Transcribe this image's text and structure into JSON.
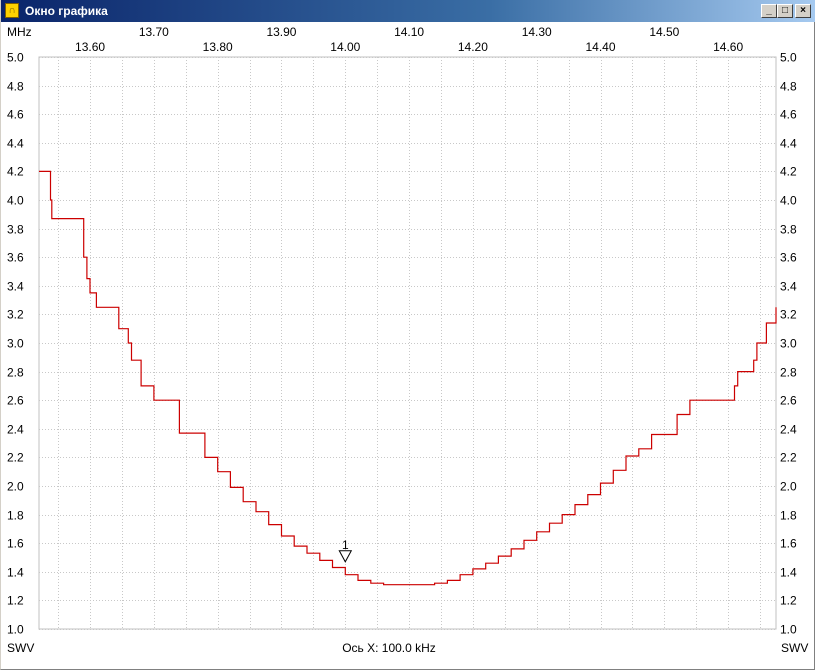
{
  "window": {
    "title": "Окно графика",
    "icon": "chart-app-icon",
    "buttons": {
      "minimize": "_",
      "maximize": "□",
      "close": "×"
    }
  },
  "chart_data": {
    "type": "line",
    "x_unit": "MHz",
    "y_label_left": "SWV",
    "y_label_right": "SWV",
    "x_axis_caption": "Ось X: 100.0 kHz",
    "xlim": [
      13.52,
      14.675
    ],
    "ylim": [
      1.0,
      5.0
    ],
    "x_ticks_upper": [
      "13.70",
      "13.90",
      "14.10",
      "14.30",
      "14.50"
    ],
    "x_ticks_upper_values": [
      13.7,
      13.9,
      14.1,
      14.3,
      14.5
    ],
    "x_ticks_lower": [
      "13.60",
      "13.80",
      "14.00",
      "14.20",
      "14.40",
      "14.60"
    ],
    "x_ticks_lower_values": [
      13.6,
      13.8,
      14.0,
      14.2,
      14.4,
      14.6
    ],
    "y_ticks": [
      "5.0",
      "4.8",
      "4.6",
      "4.4",
      "4.2",
      "4.0",
      "3.8",
      "3.6",
      "3.4",
      "3.2",
      "3.0",
      "2.8",
      "2.6",
      "2.4",
      "2.2",
      "2.0",
      "1.8",
      "1.6",
      "1.4",
      "1.2",
      "1.0"
    ],
    "grid": true,
    "series": [
      {
        "color": "#cc0000",
        "x": [
          13.52,
          13.535,
          13.538,
          13.54,
          13.587,
          13.59,
          13.595,
          13.6,
          13.61,
          13.625,
          13.64,
          13.645,
          13.66,
          13.665,
          13.68,
          13.7,
          13.71,
          13.73,
          13.74,
          13.76,
          13.78,
          13.8,
          13.82,
          13.84,
          13.86,
          13.88,
          13.9,
          13.92,
          13.94,
          13.96,
          13.98,
          14.0,
          14.02,
          14.04,
          14.06,
          14.08,
          14.1,
          14.12,
          14.14,
          14.16,
          14.18,
          14.2,
          14.22,
          14.24,
          14.26,
          14.28,
          14.3,
          14.32,
          14.34,
          14.36,
          14.38,
          14.4,
          14.42,
          14.44,
          14.46,
          14.48,
          14.5,
          14.52,
          14.54,
          14.555,
          14.57,
          14.59,
          14.61,
          14.615,
          14.64,
          14.645,
          14.66,
          14.675
        ],
        "y": [
          4.2,
          4.2,
          4.0,
          3.87,
          3.87,
          3.6,
          3.45,
          3.35,
          3.25,
          3.25,
          3.25,
          3.1,
          3.0,
          2.88,
          2.7,
          2.6,
          2.6,
          2.6,
          2.37,
          2.37,
          2.2,
          2.1,
          1.99,
          1.89,
          1.82,
          1.73,
          1.65,
          1.58,
          1.53,
          1.48,
          1.43,
          1.38,
          1.34,
          1.32,
          1.31,
          1.31,
          1.31,
          1.31,
          1.32,
          1.34,
          1.38,
          1.42,
          1.46,
          1.51,
          1.56,
          1.62,
          1.68,
          1.74,
          1.8,
          1.87,
          1.94,
          2.02,
          2.11,
          2.21,
          2.26,
          2.36,
          2.36,
          2.5,
          2.6,
          2.6,
          2.6,
          2.6,
          2.7,
          2.8,
          2.88,
          3.0,
          3.14,
          3.25
        ]
      }
    ],
    "marker": {
      "label": "1",
      "x": 14.0,
      "y": 1.47
    }
  }
}
